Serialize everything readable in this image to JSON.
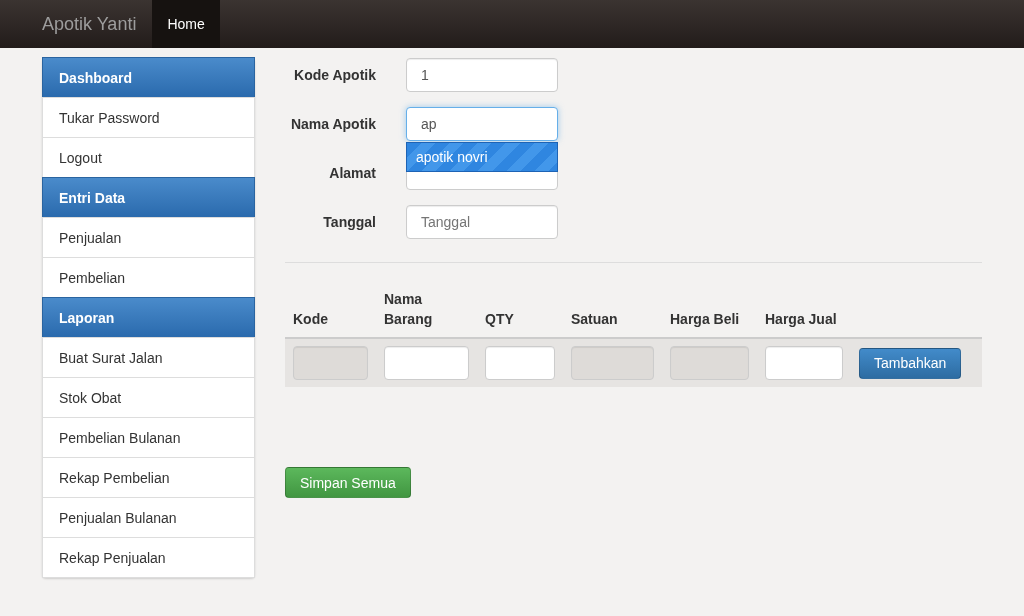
{
  "navbar": {
    "brand": "Apotik Yanti",
    "tabs": [
      {
        "label": "Home",
        "selected": true
      }
    ]
  },
  "sidebar": {
    "items": [
      {
        "label": "Dashboard",
        "kind": "header"
      },
      {
        "label": "Tukar Password",
        "kind": "link"
      },
      {
        "label": "Logout",
        "kind": "link"
      },
      {
        "label": "Entri Data",
        "kind": "header"
      },
      {
        "label": "Penjualan",
        "kind": "link"
      },
      {
        "label": "Pembelian",
        "kind": "link"
      },
      {
        "label": "Laporan",
        "kind": "header"
      },
      {
        "label": "Buat Surat Jalan",
        "kind": "link"
      },
      {
        "label": "Stok Obat",
        "kind": "link"
      },
      {
        "label": "Pembelian Bulanan",
        "kind": "link"
      },
      {
        "label": "Rekap Pembelian",
        "kind": "link"
      },
      {
        "label": "Penjualan Bulanan",
        "kind": "link"
      },
      {
        "label": "Rekap Penjualan",
        "kind": "link"
      }
    ]
  },
  "form": {
    "fields": [
      {
        "label": "Kode Apotik",
        "value": "1",
        "focused": false
      },
      {
        "label": "Nama Apotik",
        "value": "ap",
        "focused": true,
        "suggestions": [
          "apotik novri"
        ]
      },
      {
        "label": "Alamat",
        "focused": false
      },
      {
        "label": "Tanggal",
        "placeholder": "Tanggal",
        "focused": false
      }
    ]
  },
  "table": {
    "columns": [
      {
        "label": "Kode",
        "disabled": true
      },
      {
        "label": "Nama Barang",
        "disabled": false
      },
      {
        "label": "QTY",
        "disabled": false
      },
      {
        "label": "Satuan",
        "disabled": true
      },
      {
        "label": "Harga Beli",
        "disabled": true
      },
      {
        "label": "Harga Jual",
        "disabled": false
      }
    ],
    "add_button": "Tambahkan"
  },
  "save_button": "Simpan Semua"
}
